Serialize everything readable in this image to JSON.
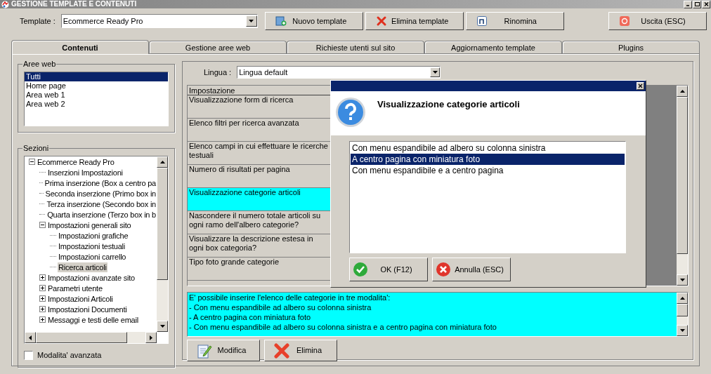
{
  "window": {
    "title": "GESTIONE TEMPLATE E CONTENUTI"
  },
  "toolbar": {
    "template_label": "Template :",
    "template_value": "Ecommerce Ready Pro",
    "buttons": [
      {
        "label": "Nuovo template",
        "kind": "new"
      },
      {
        "label": "Elimina template",
        "kind": "delete"
      },
      {
        "label": "Rinomina",
        "kind": "rename"
      },
      {
        "label": "Uscita (ESC)",
        "kind": "exit"
      }
    ]
  },
  "tabs": [
    {
      "label": "Contenuti",
      "selected": true
    },
    {
      "label": "Gestione aree web",
      "selected": false
    },
    {
      "label": "Richieste utenti sul sito",
      "selected": false
    },
    {
      "label": "Aggiornamento template",
      "selected": false
    },
    {
      "label": "Plugins",
      "selected": false
    }
  ],
  "aree_web": {
    "title": "Aree web",
    "items": [
      {
        "label": "Tutti",
        "selected": true
      },
      {
        "label": "Home page",
        "selected": false
      },
      {
        "label": "Area web 1",
        "selected": false
      },
      {
        "label": "Area web 2",
        "selected": false
      }
    ]
  },
  "sezioni": {
    "title": "Sezioni",
    "tree": [
      {
        "label": "Ecommerce Ready Pro",
        "selected": false,
        "expanded": true,
        "children": [
          {
            "label": "Inserzioni Impostazioni",
            "selected": false
          },
          {
            "label": "Prima inserzione (Box a centro pa",
            "selected": false
          },
          {
            "label": "Seconda inserzione (Primo box in",
            "selected": false
          },
          {
            "label": "Terza inserzione (Secondo box in",
            "selected": false
          },
          {
            "label": "Quarta inserzione (Terzo box in b",
            "selected": false
          },
          {
            "label": "Impostazioni generali sito",
            "selected": false,
            "expanded": true,
            "children": [
              {
                "label": "Impostazioni grafiche",
                "selected": false
              },
              {
                "label": "Impostazioni testuali",
                "selected": false
              },
              {
                "label": "Impostazioni carrello",
                "selected": false
              },
              {
                "label": "Ricerca articoli",
                "selected": true
              }
            ]
          },
          {
            "label": "Impostazioni avanzate sito",
            "selected": false,
            "expanded": false
          },
          {
            "label": "Parametri utente",
            "selected": false,
            "expanded": false
          },
          {
            "label": "Impostazioni Articoli",
            "selected": false,
            "expanded": false
          },
          {
            "label": "Impostazioni Documenti",
            "selected": false,
            "expanded": false
          },
          {
            "label": "Messaggi e testi delle email",
            "selected": false,
            "expanded": false
          }
        ]
      }
    ]
  },
  "advanced_mode": {
    "label": "Modalita' avanzata",
    "checked": false
  },
  "lingua": {
    "label": "Lingua :",
    "value": "Lingua default"
  },
  "settings_table": {
    "column": "Impostazione",
    "rows": [
      {
        "label": "Visualizzazione form di ricerca",
        "selected": false
      },
      {
        "label": "Elenco filtri per ricerca avanzata",
        "selected": false
      },
      {
        "label": "Elenco campi in cui effettuare le ricerche testuali",
        "selected": false
      },
      {
        "label": "Numero di risultati per pagina",
        "selected": false
      },
      {
        "label": "Visualizzazione categorie articoli",
        "selected": true
      },
      {
        "label": "Nascondere il numero totale articoli su ogni ramo dell'albero categorie?",
        "selected": false
      },
      {
        "label": "Visualizzare la descrizione estesa in ogni box categoria?",
        "selected": false
      },
      {
        "label": "Tipo foto grande categorie",
        "selected": false
      }
    ]
  },
  "description": {
    "lines": [
      "E' possibile inserire l'elenco delle categorie in tre modalita':",
      "- Con menu espandibile ad albero su colonna sinistra",
      "- A centro pagina con miniatura foto",
      "- Con menu espandibile ad albero su colonna sinistra e a centro pagina con miniatura foto"
    ]
  },
  "actions": [
    {
      "label": "Modifica",
      "kind": "edit"
    },
    {
      "label": "Elimina",
      "kind": "delete"
    }
  ],
  "dialog": {
    "title": "Visualizzazione categorie articoli",
    "options": [
      {
        "label": "Con menu espandibile ad albero su colonna sinistra",
        "selected": false
      },
      {
        "label": "A centro pagina con miniatura foto",
        "selected": true
      },
      {
        "label": "Con menu espandibile e a centro pagina",
        "selected": false
      }
    ],
    "buttons": [
      {
        "label": "OK (F12)",
        "kind": "ok"
      },
      {
        "label": "Annulla (ESC)",
        "kind": "cancel"
      }
    ]
  }
}
